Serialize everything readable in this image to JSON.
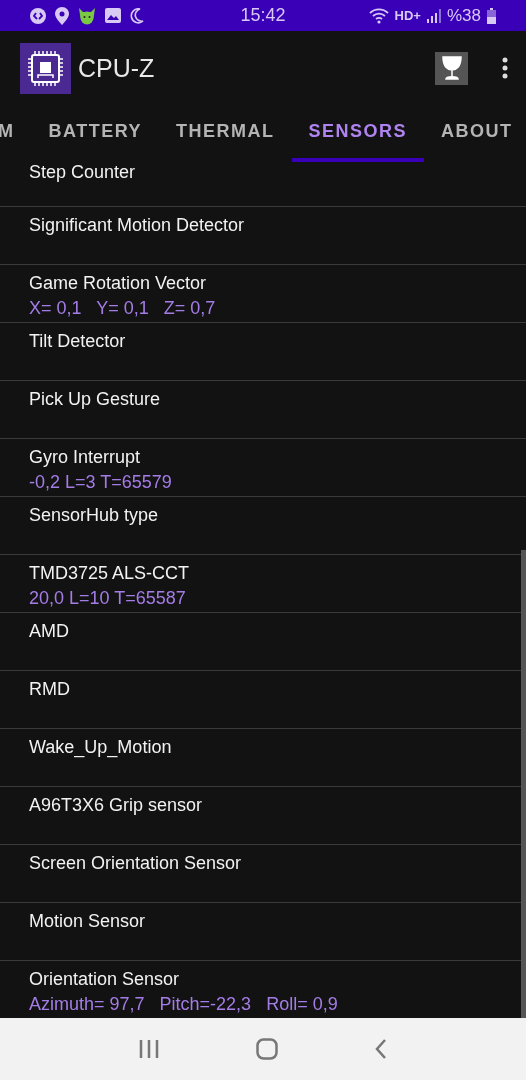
{
  "status_bar": {
    "time": "15:42",
    "network": "HD+",
    "battery": "%38"
  },
  "app_bar": {
    "title": "CPU-Z"
  },
  "tabs": [
    {
      "label": "M",
      "selected": false
    },
    {
      "label": "BATTERY",
      "selected": false
    },
    {
      "label": "THERMAL",
      "selected": false
    },
    {
      "label": "SENSORS",
      "selected": true
    },
    {
      "label": "ABOUT",
      "selected": false
    }
  ],
  "sensors": [
    {
      "name": "Step Counter"
    },
    {
      "name": "Significant Motion Detector"
    },
    {
      "name": "Game Rotation Vector",
      "value": "X= 0,1   Y= 0,1   Z= 0,7"
    },
    {
      "name": "Tilt Detector"
    },
    {
      "name": "Pick Up Gesture"
    },
    {
      "name": "Gyro Interrupt",
      "value": "-0,2 L=3 T=65579"
    },
    {
      "name": "SensorHub type"
    },
    {
      "name": "TMD3725 ALS-CCT",
      "value": "20,0 L=10 T=65587"
    },
    {
      "name": "AMD"
    },
    {
      "name": "RMD"
    },
    {
      "name": "Wake_Up_Motion"
    },
    {
      "name": "A96T3X6 Grip sensor"
    },
    {
      "name": "Screen Orientation Sensor"
    },
    {
      "name": "Motion Sensor"
    },
    {
      "name": "Orientation Sensor",
      "value": "Azimuth= 97,7   Pitch=-22,3   Roll= 0,9"
    }
  ]
}
